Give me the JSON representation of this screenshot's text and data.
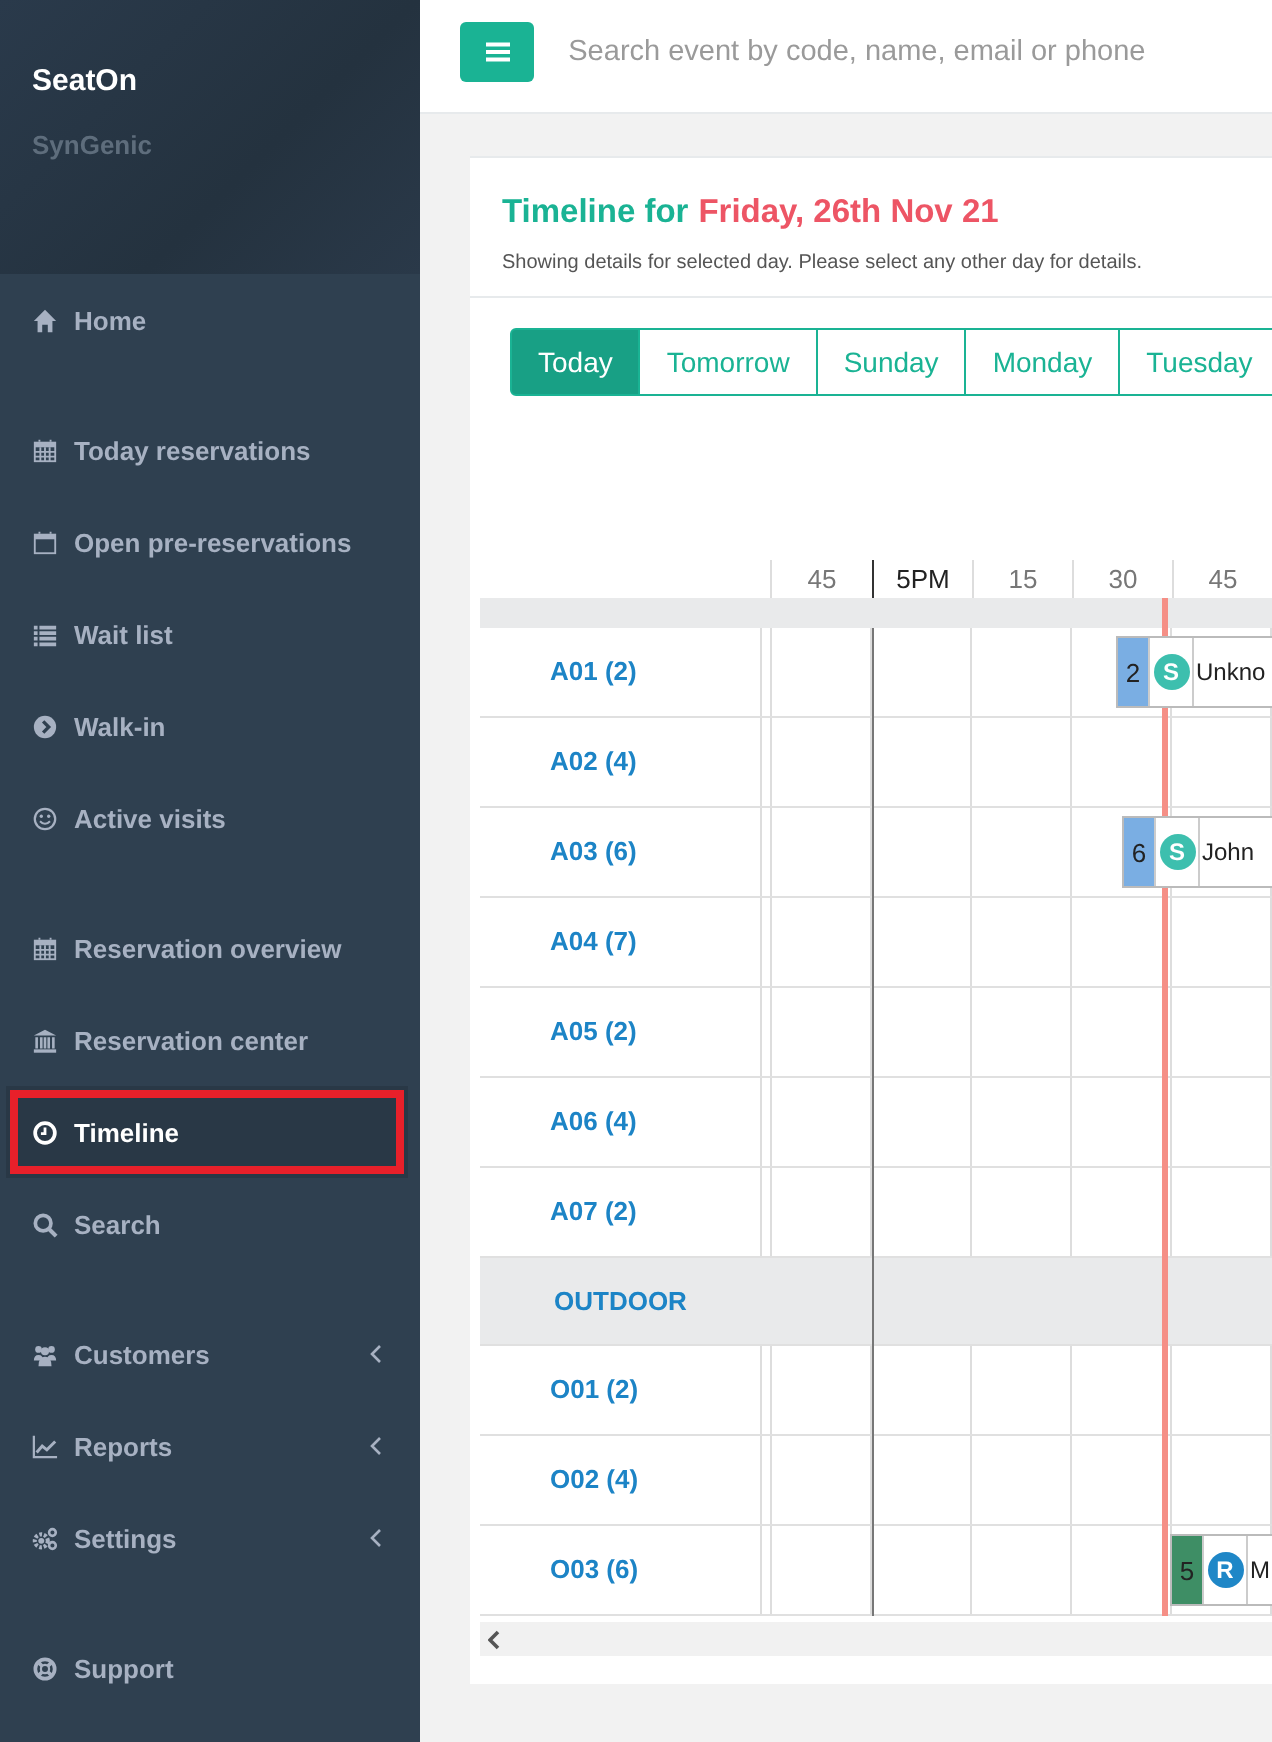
{
  "brand": {
    "name": "SeatOn",
    "subtitle": "SynGenic"
  },
  "sidebar": {
    "sections": [
      {
        "items": [
          {
            "label": "Home",
            "kind": "home",
            "selected": false,
            "expandable": false,
            "highlighted": false
          }
        ]
      },
      {
        "items": [
          {
            "label": "Today reservations",
            "kind": "calendar",
            "selected": false,
            "expandable": false,
            "highlighted": false
          },
          {
            "label": "Open pre-reservations",
            "kind": "calendar-empty",
            "selected": false,
            "expandable": false,
            "highlighted": false
          },
          {
            "label": "Wait list",
            "kind": "list",
            "selected": false,
            "expandable": false,
            "highlighted": false
          },
          {
            "label": "Walk-in",
            "kind": "play",
            "selected": false,
            "expandable": false,
            "highlighted": false
          },
          {
            "label": "Active visits",
            "kind": "smile",
            "selected": false,
            "expandable": false,
            "highlighted": false
          }
        ]
      },
      {
        "items": [
          {
            "label": "Reservation overview",
            "kind": "calendar",
            "selected": false,
            "expandable": false,
            "highlighted": false
          },
          {
            "label": "Reservation center",
            "kind": "bank",
            "selected": false,
            "expandable": false,
            "highlighted": false
          },
          {
            "label": "Timeline",
            "kind": "clock",
            "selected": true,
            "expandable": false,
            "highlighted": true
          },
          {
            "label": "Search",
            "kind": "search",
            "selected": false,
            "expandable": false,
            "highlighted": false
          }
        ]
      },
      {
        "items": [
          {
            "label": "Customers",
            "kind": "users",
            "selected": false,
            "expandable": true,
            "highlighted": false
          },
          {
            "label": "Reports",
            "kind": "chart",
            "selected": false,
            "expandable": true,
            "highlighted": false
          },
          {
            "label": "Settings",
            "kind": "cogs",
            "selected": false,
            "expandable": true,
            "highlighted": false
          }
        ]
      },
      {
        "items": [
          {
            "label": "Support",
            "kind": "lifebuoy",
            "selected": false,
            "expandable": false,
            "highlighted": false
          }
        ]
      }
    ]
  },
  "top_bar": {
    "search": {
      "placeholder": "Search event by code, name, email or phone"
    }
  },
  "card": {
    "title": {
      "prefix": "Timeline for",
      "date": "Friday, 26th Nov 21"
    },
    "subtitle": "Showing details for selected day. Please select any other day for details.",
    "day_tabs": [
      {
        "label": "Today",
        "selected": true
      },
      {
        "label": "Tomorrow",
        "selected": false
      },
      {
        "label": "Sunday",
        "selected": false
      },
      {
        "label": "Monday",
        "selected": false
      },
      {
        "label": "Tuesday",
        "selected": false
      }
    ],
    "timeline": {
      "time_labels": [
        {
          "label": "45",
          "kind": "quarter"
        },
        {
          "label": "5PM",
          "kind": "hour"
        },
        {
          "label": "15",
          "kind": "quarter"
        },
        {
          "label": "30",
          "kind": "quarter"
        },
        {
          "label": "45",
          "kind": "quarter"
        }
      ],
      "sections": [
        {
          "rows": [
            {
              "label": "A01 (2)",
              "bookings": [
                {
                  "party_size": "2",
                  "color": "#7aaee3",
                  "status": {
                    "letter": "S",
                    "color": "#3dbfae"
                  },
                  "name": "Unkno"
                }
              ]
            },
            {
              "label": "A02 (4)",
              "bookings": []
            },
            {
              "label": "A03 (6)",
              "bookings": [
                {
                  "party_size": "6",
                  "color": "#7aaee3",
                  "status": {
                    "letter": "S",
                    "color": "#3dbfae"
                  },
                  "name": "John"
                }
              ]
            },
            {
              "label": "A04 (7)",
              "bookings": []
            },
            {
              "label": "A05 (2)",
              "bookings": []
            },
            {
              "label": "A06 (4)",
              "bookings": []
            },
            {
              "label": "A07 (2)",
              "bookings": []
            }
          ]
        },
        {
          "title": "OUTDOOR",
          "rows": [
            {
              "label": "O01 (2)",
              "bookings": []
            },
            {
              "label": "O02 (4)",
              "bookings": []
            },
            {
              "label": "O03 (6)",
              "bookings": [
                {
                  "party_size": "5",
                  "color": "#3e8e65",
                  "status": {
                    "letter": "R",
                    "color": "#1f87c7"
                  },
                  "name": "M"
                }
              ]
            }
          ]
        }
      ]
    }
  }
}
